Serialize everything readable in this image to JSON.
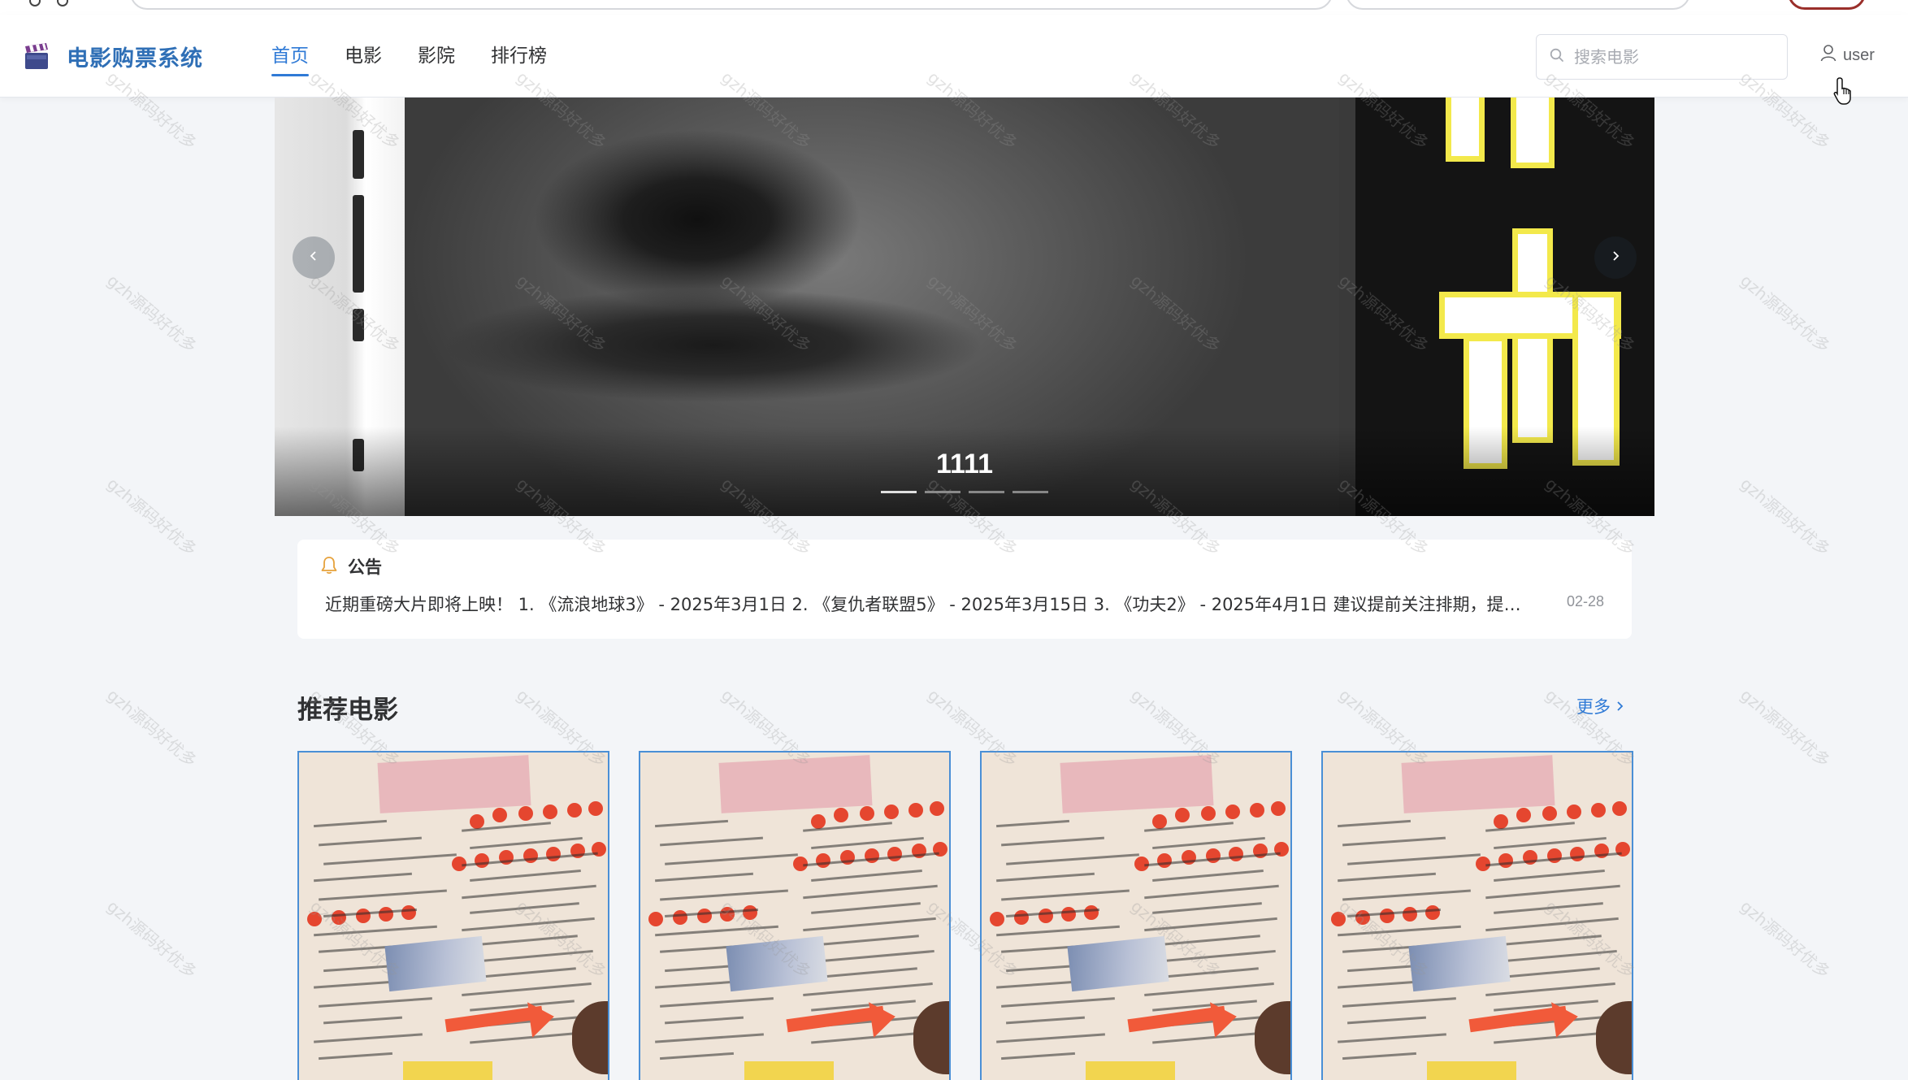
{
  "app": {
    "title": "电影购票系统",
    "logo_icon": "clapperboard-icon"
  },
  "nav": {
    "items": [
      {
        "label": "首页",
        "active": true
      },
      {
        "label": "电影",
        "active": false
      },
      {
        "label": "影院",
        "active": false
      },
      {
        "label": "排行榜",
        "active": false
      }
    ]
  },
  "search": {
    "placeholder": "搜索电影",
    "value": ""
  },
  "user": {
    "label": "user"
  },
  "carousel": {
    "caption": "1111",
    "slide_count": 4,
    "active_index": 0
  },
  "notice": {
    "title": "公告",
    "text": "近期重磅大片即将上映！ 1. 《流浪地球3》 - 2025年3月1日 2. 《复仇者联盟5》 - 2025年3月15日 3. 《功夫2》 - 2025年4月1日 建议提前关注排期，提前购票",
    "date": "02-28"
  },
  "recommend": {
    "title": "推荐电影",
    "more_label": "更多"
  },
  "watermark": {
    "text": "gzh源码好优多"
  },
  "colors": {
    "accent": "#2f7ad6",
    "logo_text": "#2f6fb6",
    "background": "#f3f5f8",
    "card_border": "#4a8fd6"
  }
}
